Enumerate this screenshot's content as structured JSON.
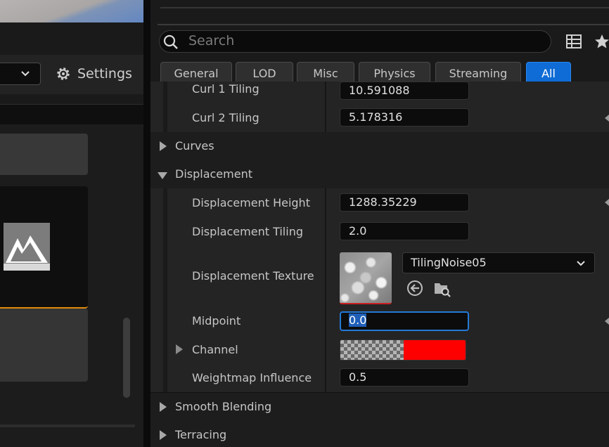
{
  "left_panel": {
    "settings_label": "Settings"
  },
  "search": {
    "placeholder": "Search"
  },
  "filters": [
    {
      "label": "General"
    },
    {
      "label": "LOD"
    },
    {
      "label": "Misc"
    },
    {
      "label": "Physics"
    },
    {
      "label": "Streaming"
    },
    {
      "label": "All",
      "active": true
    }
  ],
  "properties": {
    "curl1": {
      "label": "Curl 1 Tiling",
      "value": "10.591088"
    },
    "curl2": {
      "label": "Curl 2 Tiling",
      "value": "5.178316"
    },
    "curves": {
      "label": "Curves"
    },
    "displacement": {
      "label": "Displacement"
    },
    "disp_height": {
      "label": "Displacement Height",
      "value": "1288.35229"
    },
    "disp_tiling": {
      "label": "Displacement Tiling",
      "value": "2.0"
    },
    "disp_texture": {
      "label": "Displacement Texture",
      "asset": "TilingNoise05"
    },
    "midpoint": {
      "label": "Midpoint",
      "value": "0.0"
    },
    "channel": {
      "label": "Channel",
      "color": "#ff0000"
    },
    "weightmap": {
      "label": "Weightmap Influence",
      "value": "0.5"
    },
    "smooth_blending": {
      "label": "Smooth Blending"
    },
    "terracing": {
      "label": "Terracing"
    }
  },
  "colors": {
    "accent": "#0f6cd6",
    "highlight": "#e08a0a"
  }
}
